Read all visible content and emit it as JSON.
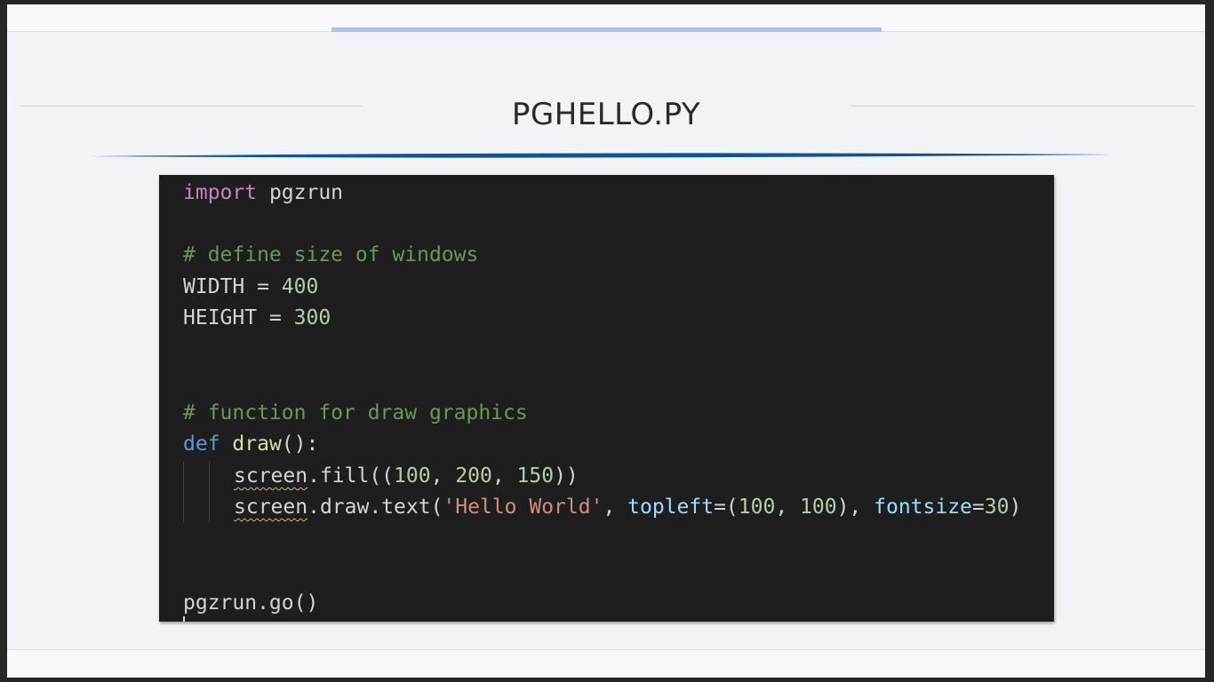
{
  "slide": {
    "title": "PGHELLO.PY",
    "colors": {
      "accent_top": "#9cc7f2",
      "title_underline": "#0f5493",
      "editor_background": "#1e1e1e"
    }
  },
  "code": {
    "line_import_keyword": "import",
    "line_import_module": " pgzrun",
    "comment_window_size": "# define size of windows",
    "width_name": "WIDTH = ",
    "width_value": "400",
    "height_name": "HEIGHT = ",
    "height_value": "300",
    "comment_draw": "# function for draw graphics",
    "def_keyword": "def",
    "def_name": "draw",
    "def_tail": "():",
    "fill_object": "screen",
    "fill_call": ".fill((",
    "fill_num1": "100",
    "fill_sep1": ", ",
    "fill_num2": "200",
    "fill_sep2": ", ",
    "fill_num3": "150",
    "fill_close": "))",
    "text_object": "screen",
    "text_call": ".draw.text(",
    "text_string": "'Hello World'",
    "text_sep1": ", ",
    "text_param1": "topleft",
    "text_eq1": "=(",
    "text_num1": "100",
    "text_sep2": ", ",
    "text_num2": "100",
    "text_close1": "), ",
    "text_param2": "fontsize",
    "text_eq2": "=",
    "text_num3": "30",
    "text_close2": ")",
    "go_call": "pgzrun.go()"
  }
}
